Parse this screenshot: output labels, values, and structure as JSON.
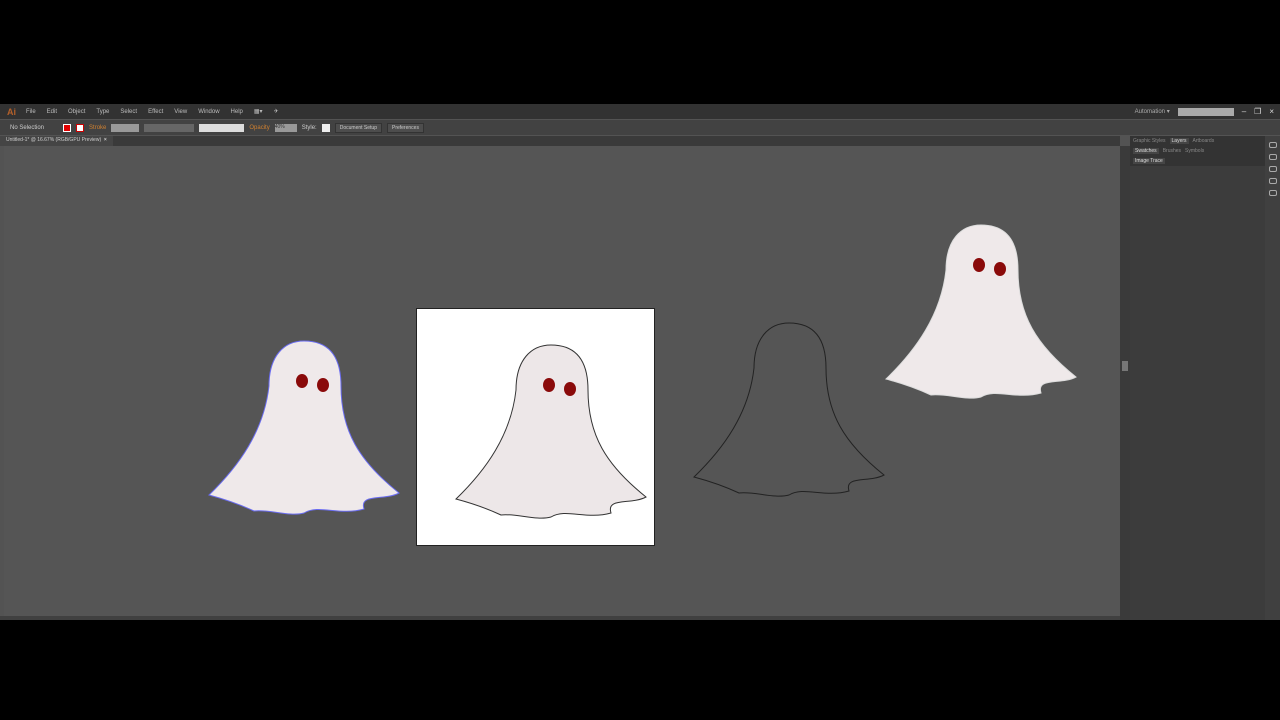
{
  "menubar": {
    "logo": "Ai",
    "items": [
      "File",
      "Edit",
      "Object",
      "Type",
      "Select",
      "Effect",
      "View",
      "Window",
      "Help"
    ],
    "workspace": "Automation ▾"
  },
  "control": {
    "selection": "No Selection",
    "stroke": "Stroke",
    "opacity_label": "Opacity",
    "opacity_value": "40%",
    "style_label": "Style:",
    "document_setup": "Document Setup",
    "preferences": "Preferences"
  },
  "document": {
    "tab": "Untitled-1* @ 16.67% (RGB/GPU Preview)",
    "close": "×"
  },
  "panels": {
    "row1": [
      "Graphic Styles",
      "Layers",
      "Artboards"
    ],
    "row2": [
      "Swatches",
      "Brushes",
      "Symbols"
    ],
    "row3": [
      "Image Trace"
    ]
  },
  "colors": {
    "fill": "#e00000",
    "canvas": "#555555",
    "ghost": "#efe9ea",
    "eye": "#8a0a0a"
  }
}
